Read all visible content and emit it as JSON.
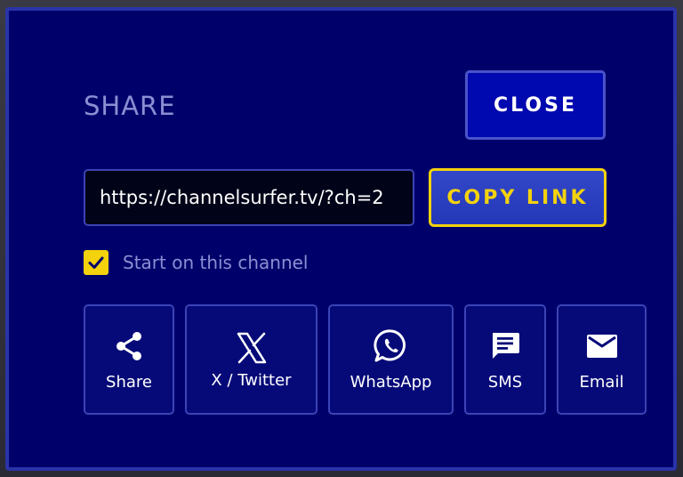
{
  "dialog": {
    "title": "SHARE",
    "close_label": "CLOSE",
    "url_value": "https://channelsurfer.tv/?ch=2",
    "copy_label": "COPY LINK",
    "checkbox_label": "Start on this channel",
    "checkbox_checked": true
  },
  "share_options": [
    {
      "label": "Share",
      "icon": "share-icon"
    },
    {
      "label": "X / Twitter",
      "icon": "x-twitter-icon"
    },
    {
      "label": "WhatsApp",
      "icon": "whatsapp-icon"
    },
    {
      "label": "SMS",
      "icon": "sms-icon"
    },
    {
      "label": "Email",
      "icon": "email-icon"
    }
  ],
  "colors": {
    "dialog_bg": "#00006b",
    "border": "#3b43b5",
    "accent_yellow": "#f4d20c",
    "muted_text": "#8b8fd2"
  }
}
